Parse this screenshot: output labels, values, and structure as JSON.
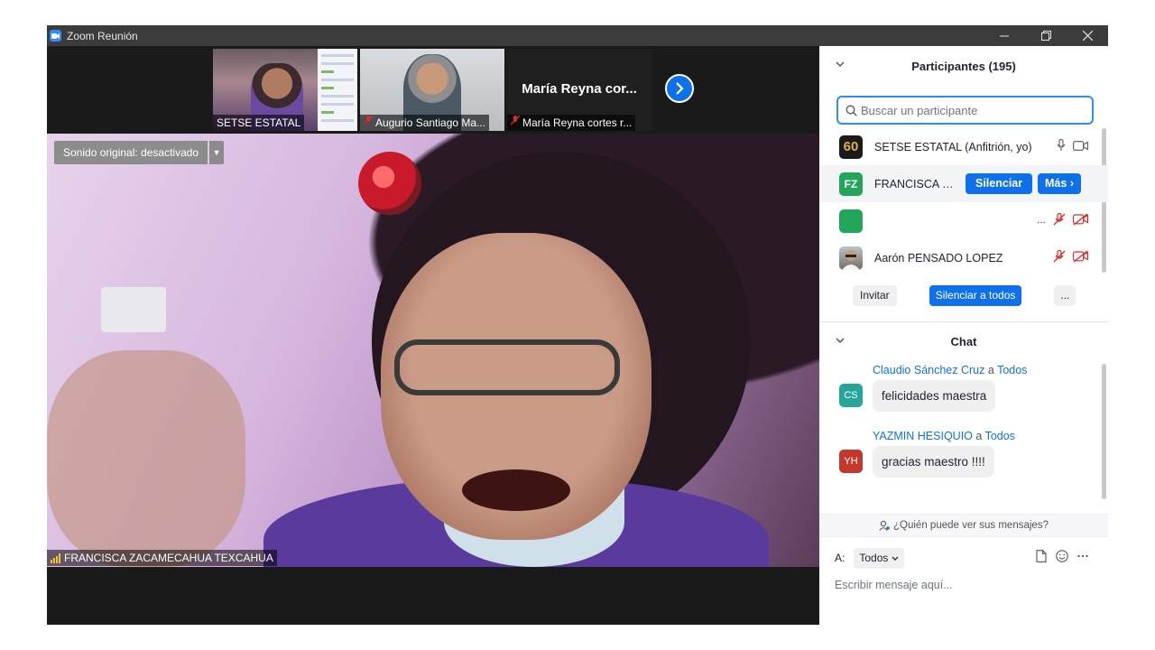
{
  "window": {
    "title": "Zoom Reunión"
  },
  "thumbnails": [
    {
      "label": "SETSE ESTATAL",
      "muted": false
    },
    {
      "label": "Augurio Santiago Ma...",
      "muted": true
    },
    {
      "big_name": "María  Reyna  cor...",
      "label": "María Reyna cortes r...",
      "muted": true
    }
  ],
  "video": {
    "sound_button": "Sonido original: desactivado",
    "active_speaker": "FRANCISCA ZACAMECAHUA TEXCAHUA"
  },
  "participants": {
    "header": "Participantes (195)",
    "search_placeholder": "Buscar un participante",
    "rows": [
      {
        "avatar_text": "60",
        "avatar_color": "#1a1a1a",
        "name": "SETSE ESTATAL (Anfitrión, yo)"
      },
      {
        "avatar_text": "FZ",
        "avatar_color": "#23a55a",
        "name": "FRANCISCA ZA...",
        "mute_button": "Silenciar",
        "more_button": "Más"
      },
      {
        "avatar_text": "",
        "avatar_color": "#23a55a",
        "name": "",
        "ellipsis": "..."
      },
      {
        "avatar_text": "",
        "avatar_color": "#8a9aa8",
        "name": "Aarón PENSADO LOPEZ"
      }
    ],
    "invite_button": "Invitar",
    "mute_all_button": "Silenciar a todos",
    "more_button": "..."
  },
  "chat": {
    "header": "Chat",
    "messages": [
      {
        "sender": "Claudio Sánchez Cruz",
        "to_word": "a",
        "recipient": "Todos",
        "initials": "CS",
        "avatar_color": "#26a69a",
        "text": "felicidades maestra"
      },
      {
        "sender": "YAZMIN HESIQUIO",
        "to_word": "a",
        "recipient": "Todos",
        "initials": "YH",
        "avatar_color": "#c0392b",
        "text": "gracias maestro !!!!"
      }
    ],
    "who_can_see": "¿Quién puede ver sus mensajes?",
    "to_label": "A:",
    "to_value": "Todos",
    "compose_placeholder": "Escribir mensaje aquí..."
  },
  "colors": {
    "accent": "#0e71eb",
    "muted_red": "#e02828",
    "titlebar": "#3c3c3c"
  }
}
